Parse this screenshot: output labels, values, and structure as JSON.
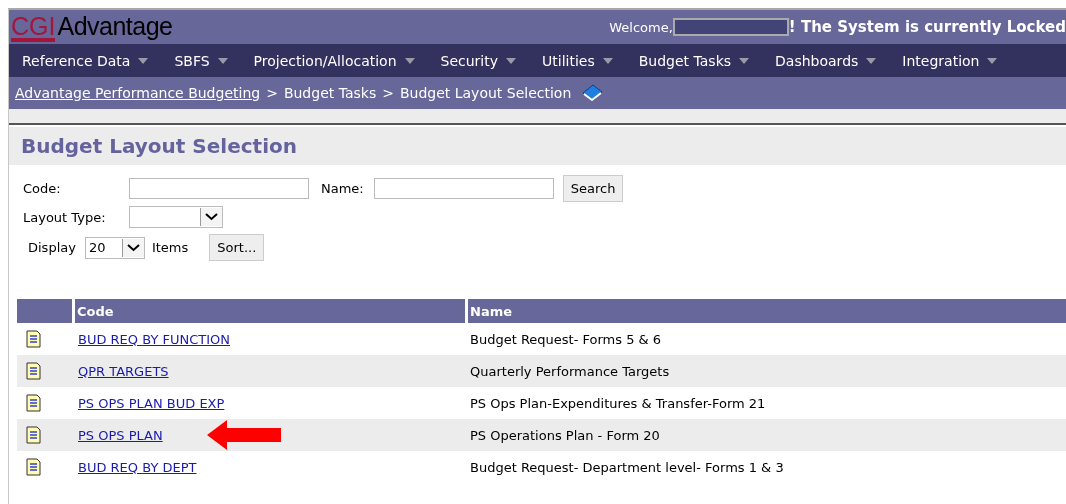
{
  "header": {
    "logo_mark": "CGI",
    "logo_text": "Advantage",
    "welcome": "Welcome,",
    "notice": "! The System is currently Locked"
  },
  "nav": [
    {
      "label": "Reference Data"
    },
    {
      "label": "SBFS"
    },
    {
      "label": "Projection/Allocation"
    },
    {
      "label": "Security"
    },
    {
      "label": "Utilities"
    },
    {
      "label": "Budget Tasks"
    },
    {
      "label": "Dashboards"
    },
    {
      "label": "Integration"
    }
  ],
  "breadcrumb": [
    {
      "label": "Advantage Performance Budgeting",
      "link": true
    },
    {
      "label": "Budget Tasks",
      "link": false
    },
    {
      "label": "Budget Layout Selection",
      "link": false
    }
  ],
  "breadcrumb_separator": ">",
  "page_title": "Budget Layout Selection",
  "form": {
    "code_label": "Code:",
    "name_label": "Name:",
    "search_button": "Search",
    "layout_type_label": "Layout Type:",
    "display_label": "Display",
    "display_value": "20",
    "items_label": "Items",
    "sort_button": "Sort..."
  },
  "table": {
    "columns": [
      "Code",
      "Name"
    ],
    "rows": [
      {
        "code": "BUD REQ BY FUNCTION",
        "name": "Budget Request- Forms 5 & 6",
        "pointed": false
      },
      {
        "code": "QPR TARGETS",
        "name": "Quarterly Performance Targets",
        "pointed": false
      },
      {
        "code": "PS OPS PLAN BUD EXP",
        "name": "PS Ops Plan-Expenditures & Transfer-Form 21",
        "pointed": false
      },
      {
        "code": "PS OPS PLAN",
        "name": "PS Operations Plan - Form 20",
        "pointed": true
      },
      {
        "code": "BUD REQ BY DEPT",
        "name": "Budget Request- Department level- Forms 1 & 3",
        "pointed": false
      }
    ]
  }
}
